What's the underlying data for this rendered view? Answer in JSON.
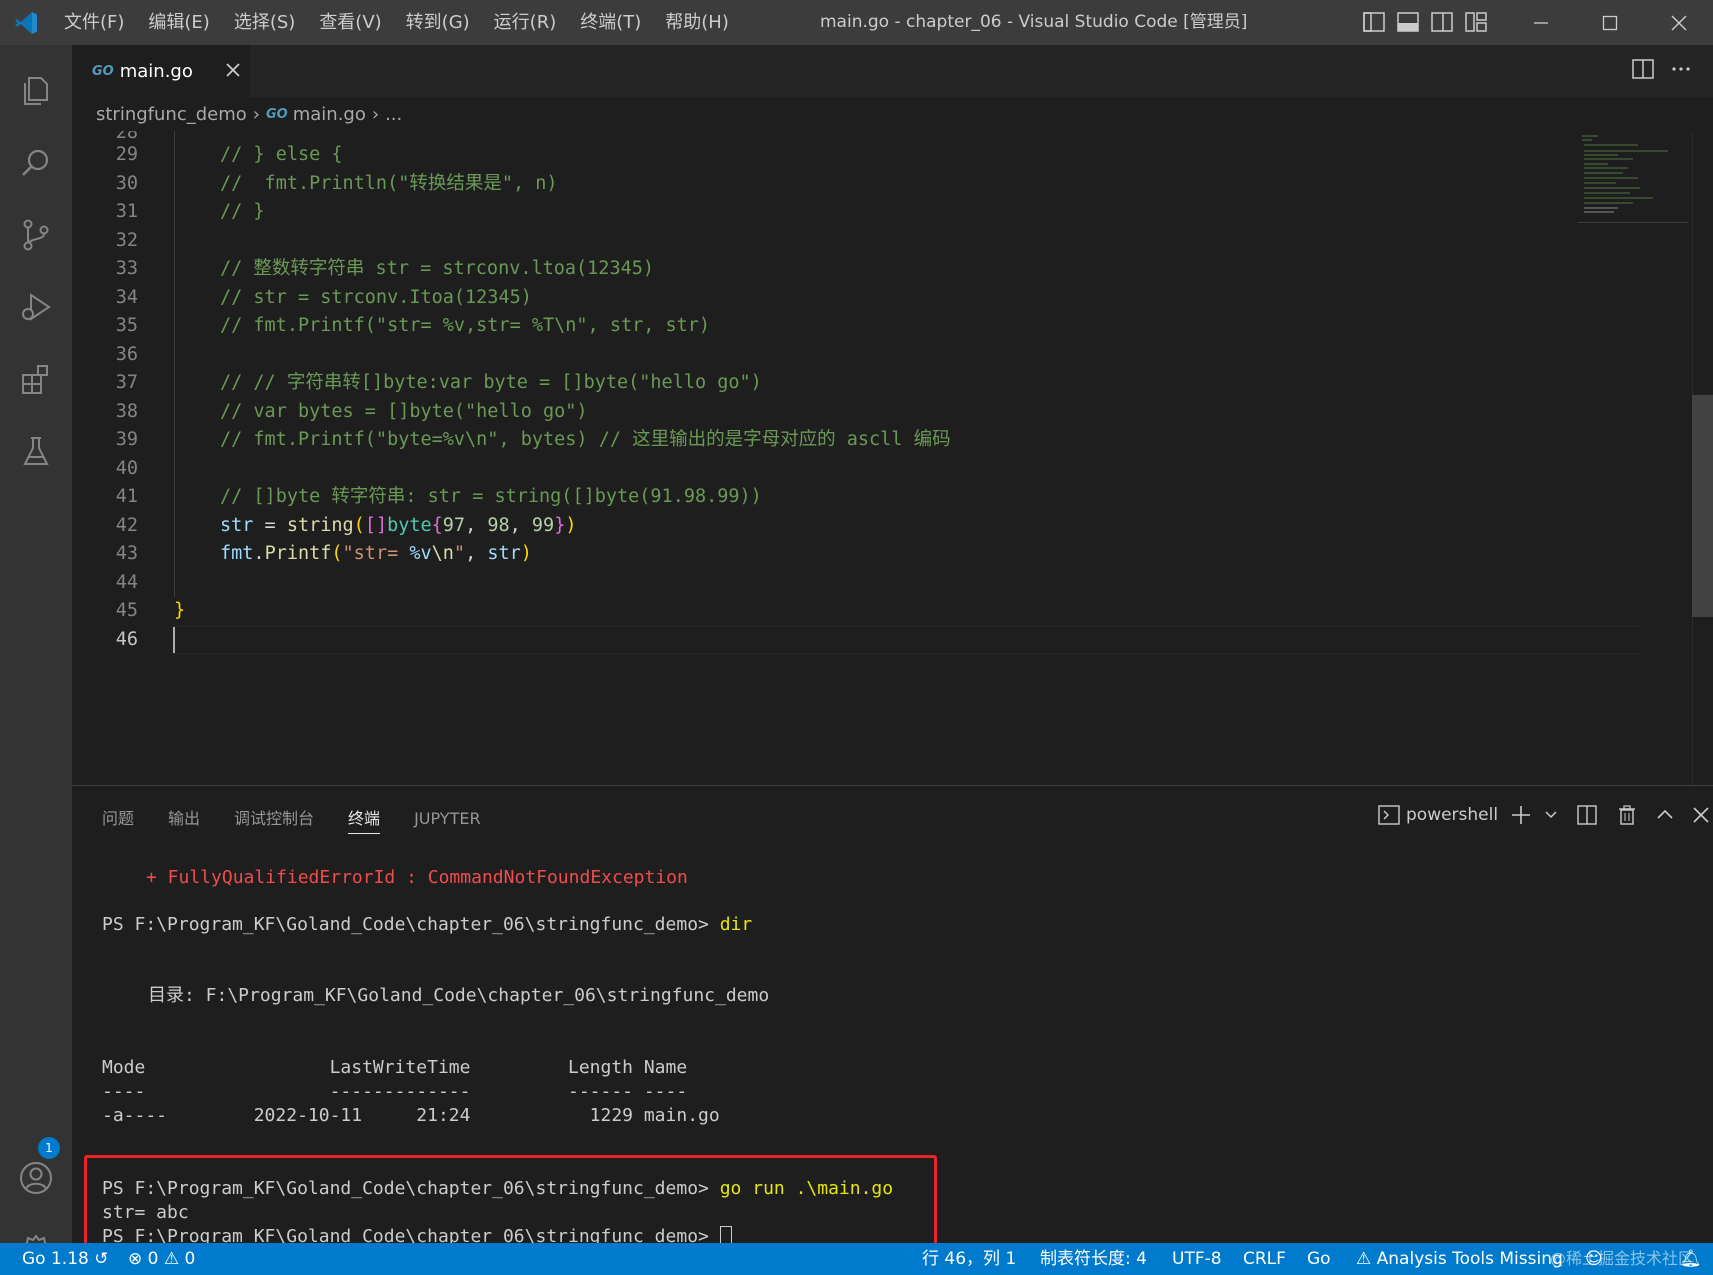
{
  "titlebar": {
    "menu": [
      "文件(F)",
      "编辑(E)",
      "选择(S)",
      "查看(V)",
      "转到(G)",
      "运行(R)",
      "终端(T)",
      "帮助(H)"
    ],
    "title": "main.go - chapter_06 - Visual Studio Code [管理员]"
  },
  "tab": {
    "label": "main.go",
    "icon": "GO"
  },
  "breadcrumb": {
    "folder": "stringfunc_demo",
    "file": "main.go",
    "more": "..."
  },
  "editor": {
    "lines": [
      {
        "n": "29",
        "text": "// } else {"
      },
      {
        "n": "30",
        "text": "//  fmt.Println(\"转换结果是\", n)"
      },
      {
        "n": "31",
        "text": "// }"
      },
      {
        "n": "32",
        "text": ""
      },
      {
        "n": "33",
        "text": "// 整数转字符串 str = strconv.ltoa(12345)"
      },
      {
        "n": "34",
        "text": "// str = strconv.Itoa(12345)"
      },
      {
        "n": "35",
        "text": "// fmt.Printf(\"str= %v,str= %T\\n\", str, str)"
      },
      {
        "n": "36",
        "text": ""
      },
      {
        "n": "37",
        "text": "// // 字符串转[]byte:var byte = []byte(\"hello go\")"
      },
      {
        "n": "38",
        "text": "// var bytes = []byte(\"hello go\")"
      },
      {
        "n": "39",
        "text": "// fmt.Printf(\"byte=%v\\n\", bytes) // 这里输出的是字母对应的 ascll 编码"
      },
      {
        "n": "40",
        "text": ""
      },
      {
        "n": "41",
        "text": "// []byte 转字符串: str = string([]byte(91.98.99))"
      },
      {
        "n": "42",
        "text": ""
      },
      {
        "n": "43",
        "text": ""
      },
      {
        "n": "44",
        "text": ""
      },
      {
        "n": "45",
        "text": ""
      },
      {
        "n": "46",
        "text": ""
      }
    ],
    "line42": {
      "var": "str",
      "op": " = ",
      "fn": "string",
      "p1": "(",
      "b1": "[]",
      "type": "byte",
      "b2": "{",
      "v1": "97",
      "s1": ", ",
      "v2": "98",
      "s2": ", ",
      "v3": "99",
      "b3": "}",
      "p2": ")"
    },
    "line43": {
      "pkg": "fmt",
      "dot": ".",
      "fn": "Printf",
      "p1": "(",
      "q1": "\"str= ",
      "fmt": "%v",
      "esc": "\\n",
      "q2": "\"",
      "rest": ", ",
      "var": "str",
      "p2": ")"
    },
    "line45": "}"
  },
  "panel": {
    "tabs": [
      "问题",
      "输出",
      "调试控制台",
      "终端",
      "JUPYTER"
    ],
    "shell": "powershell",
    "terminal": {
      "err": "+ FullyQualifiedErrorId : CommandNotFoundException",
      "prompt1": "PS F:\\Program_KF\\Goland_Code\\chapter_06\\stringfunc_demo> ",
      "cmd1": "dir",
      "dirline": "目录: F:\\Program_KF\\Goland_Code\\chapter_06\\stringfunc_demo",
      "header": "Mode                 LastWriteTime         Length Name",
      "dashes": "----                 -------------         ------ ----",
      "row": "-a----        2022-10-11     21:24           1229 main.go",
      "prompt2": "PS F:\\Program_KF\\Goland_Code\\chapter_06\\stringfunc_demo> ",
      "cmd2": "go run .\\main.go",
      "output": "str= abc",
      "prompt3": "PS F:\\Program_KF\\Goland_Code\\chapter_06\\stringfunc_demo> "
    }
  },
  "statusbar": {
    "go_version": "Go 1.18",
    "errors": "0",
    "warnings": "0",
    "position": "行 46，列 1",
    "tab_size": "制表符长度: 4",
    "encoding": "UTF-8",
    "eol": "CRLF",
    "language": "Go",
    "analysis": "Analysis Tools Missing",
    "watermark": "@稀土掘金技术社区"
  },
  "colors": {
    "statusbar": "#007acc",
    "highlight_box": "#e8262a",
    "badge": "#007acc"
  },
  "activity": {
    "badge": "1"
  }
}
